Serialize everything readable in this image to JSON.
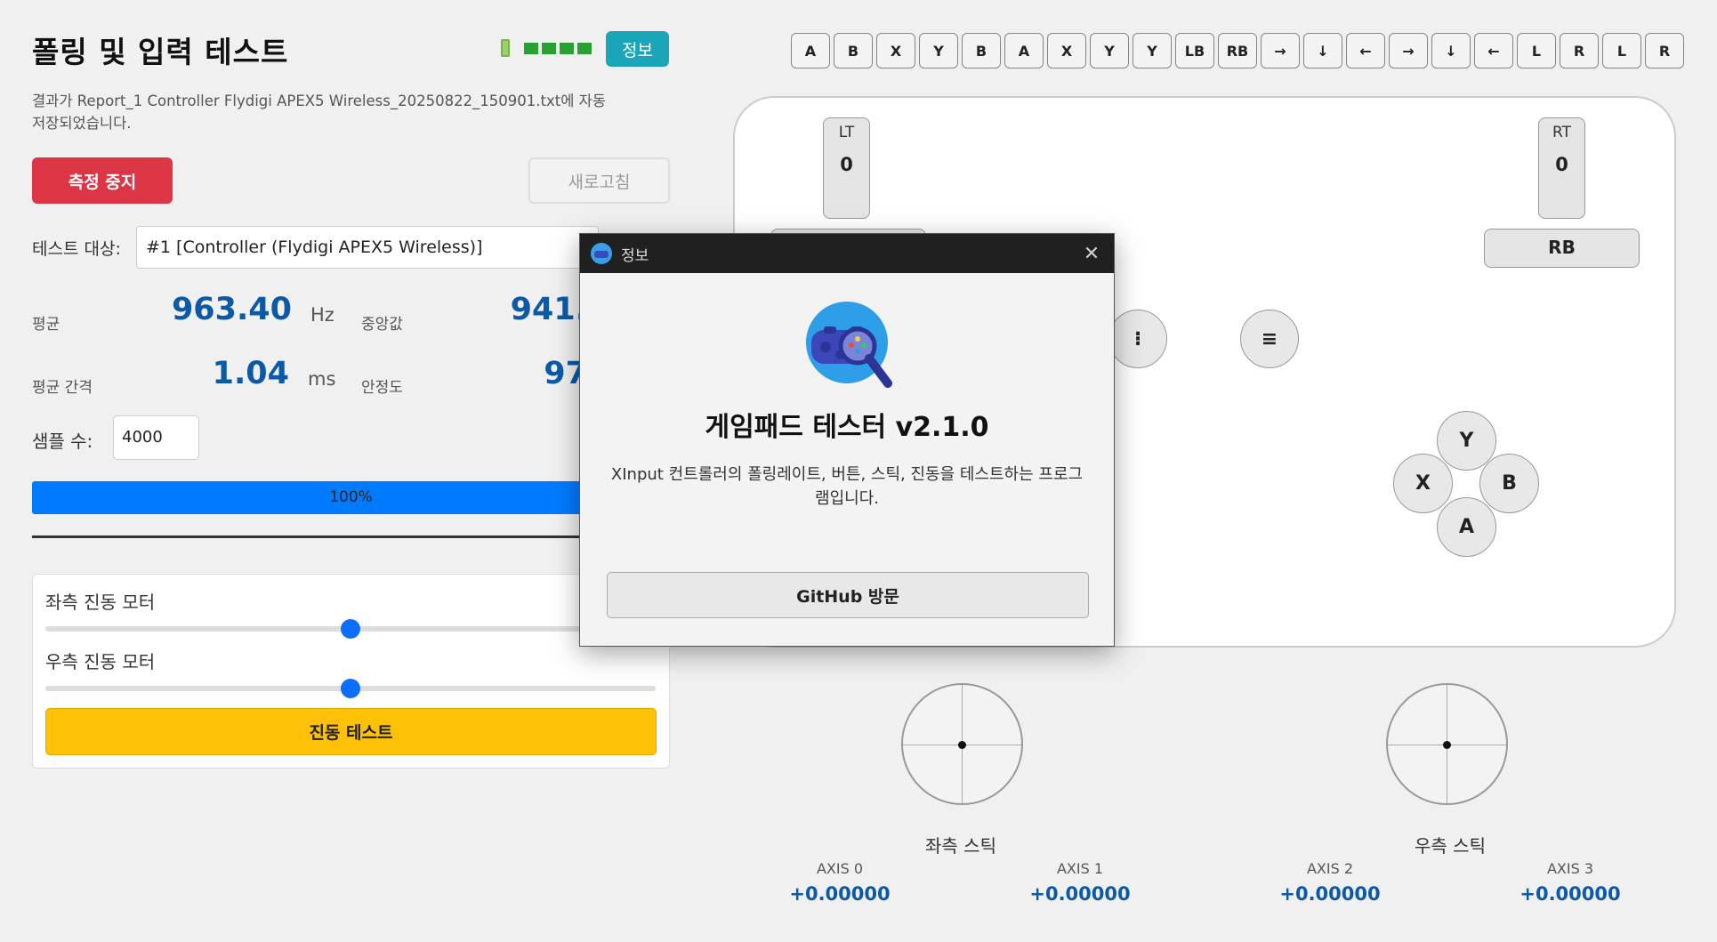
{
  "header": {
    "title": "폴링 및 입력 테스트",
    "info_button": "정보",
    "saved_message": "결과가 Report_1 Controller Flydigi APEX5 Wireless_20250822_150901.txt에 자동 저장되었습니다."
  },
  "battery": {
    "icon": "battery-plug-icon",
    "level_bars": 4,
    "color": "#2aa034"
  },
  "actions": {
    "stop_button": "측정 중지",
    "refresh_button": "새로고침"
  },
  "target": {
    "label": "테스트 대상:",
    "value": "#1 [Controller (Flydigi APEX5 Wireless)]"
  },
  "stats": {
    "avg_label": "평균",
    "avg_value": "963.40",
    "avg_unit": "Hz",
    "median_label": "중앙값",
    "median_value": "941.",
    "interval_label": "평균 간격",
    "interval_value": "1.04",
    "interval_unit": "ms",
    "stability_label": "안정도",
    "stability_value": "97"
  },
  "samples": {
    "label": "샘플 수:",
    "value": "4000"
  },
  "progress": {
    "text": "100%",
    "percent": 100,
    "color": "#007bff"
  },
  "vibration": {
    "left_label": "좌측 진동 모터",
    "left_level": 0.5,
    "right_label": "우측 진동 모터",
    "right_level": 0.5,
    "test_button": "진동 테스트",
    "button_color": "#ffc107"
  },
  "button_bar": [
    "A",
    "B",
    "X",
    "Y",
    "B",
    "A",
    "X",
    "Y",
    "Y",
    "LB",
    "RB",
    "→",
    "↓",
    "←",
    "→",
    "↓",
    "←",
    "L",
    "R",
    "L",
    "R"
  ],
  "controller": {
    "lt_label": "LT",
    "lt_value": "0",
    "rt_label": "RT",
    "rt_value": "0",
    "rb_label": "RB",
    "view_glyph": "⁝",
    "menu_glyph": "≡",
    "face": {
      "y": "Y",
      "x": "X",
      "b": "B",
      "a": "A"
    }
  },
  "sticks": {
    "left_label": "좌측 스틱",
    "right_label": "우측 스틱",
    "axes": [
      {
        "label": "AXIS 0",
        "value": "+0.00000"
      },
      {
        "label": "AXIS 1",
        "value": "+0.00000"
      },
      {
        "label": "AXIS 2",
        "value": "+0.00000"
      },
      {
        "label": "AXIS 3",
        "value": "+0.00000"
      }
    ]
  },
  "modal": {
    "title": "정보",
    "heading": "게임패드 테스터 v2.1.0",
    "description": "XInput 컨트롤러의 폴링레이트, 버튼, 스틱, 진동을 테스트하는 프로그램입니다.",
    "github_button": "GitHub 방문",
    "close_glyph": "✕",
    "logo_icon": "gamepad-magnifier-icon"
  }
}
